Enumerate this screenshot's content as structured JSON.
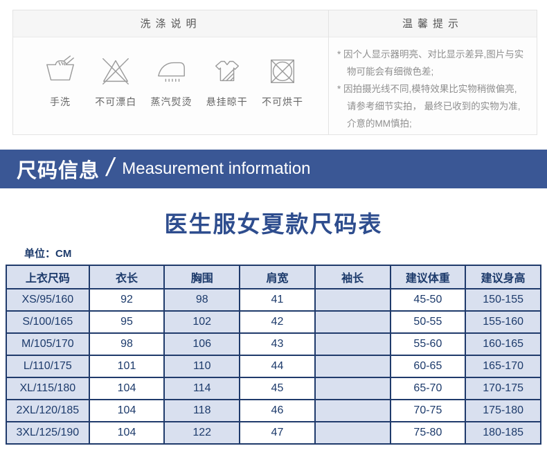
{
  "care": {
    "wash_title": "洗涤说明",
    "icons": [
      {
        "name": "hand-wash-icon",
        "label": "手洗"
      },
      {
        "name": "no-bleach-icon",
        "label": "不可漂白"
      },
      {
        "name": "steam-iron-icon",
        "label": "蒸汽熨烫"
      },
      {
        "name": "hang-dry-icon",
        "label": "悬挂晾干"
      },
      {
        "name": "no-tumble-dry-icon",
        "label": "不可烘干"
      }
    ],
    "tips_title": "温馨提示",
    "tips": [
      "* 因个人显示器明亮、对比显示差异,图片与实物可能会有细微色差;",
      "* 因拍摄光线不同,模特效果比实物稍微偏亮, 请参考细节实拍， 最终已收到的实物为准, 介意的MM慎拍;"
    ]
  },
  "banner": {
    "title_zh": "尺码信息",
    "separator": "/",
    "title_en": "Measurement information"
  },
  "size_chart": {
    "title": "医生服女夏款尺码表",
    "unit_label": "单位：CM",
    "columns": [
      "上衣尺码",
      "衣长",
      "胸围",
      "肩宽",
      "袖长",
      "建议体重",
      "建议身高"
    ],
    "rows": [
      [
        "XS/95/160",
        "92",
        "98",
        "41",
        "",
        "45-50",
        "150-155"
      ],
      [
        "S/100/165",
        "95",
        "102",
        "42",
        "",
        "50-55",
        "155-160"
      ],
      [
        "M/105/170",
        "98",
        "106",
        "43",
        "",
        "55-60",
        "160-165"
      ],
      [
        "L/110/175",
        "101",
        "110",
        "44",
        "",
        "60-65",
        "165-170"
      ],
      [
        "XL/115/180",
        "104",
        "114",
        "45",
        "",
        "65-70",
        "170-175"
      ],
      [
        "2XL/120/185",
        "104",
        "118",
        "46",
        "",
        "70-75",
        "175-180"
      ],
      [
        "3XL/125/190",
        "104",
        "122",
        "47",
        "",
        "75-80",
        "180-185"
      ]
    ]
  },
  "chart_data": {
    "type": "table",
    "title": "医生服女夏款尺码表",
    "unit": "CM",
    "columns": [
      "上衣尺码",
      "衣长",
      "胸围",
      "肩宽",
      "袖长",
      "建议体重",
      "建议身高"
    ],
    "rows": [
      [
        "XS/95/160",
        "92",
        "98",
        "41",
        "",
        "45-50",
        "150-155"
      ],
      [
        "S/100/165",
        "95",
        "102",
        "42",
        "",
        "50-55",
        "155-160"
      ],
      [
        "M/105/170",
        "98",
        "106",
        "43",
        "",
        "55-60",
        "160-165"
      ],
      [
        "L/110/175",
        "101",
        "110",
        "44",
        "",
        "60-65",
        "165-170"
      ],
      [
        "XL/115/180",
        "104",
        "114",
        "45",
        "",
        "65-70",
        "170-175"
      ],
      [
        "2XL/120/185",
        "104",
        "118",
        "46",
        "",
        "70-75",
        "175-180"
      ],
      [
        "3XL/125/190",
        "104",
        "122",
        "47",
        "",
        "75-80",
        "180-185"
      ]
    ]
  },
  "colors": {
    "banner_bg": "#3a5795",
    "table_border": "#1f3a6b",
    "table_cell_light": "#d9e0ef",
    "table_text": "#1c3a6b",
    "title_text": "#2e4d8e"
  }
}
